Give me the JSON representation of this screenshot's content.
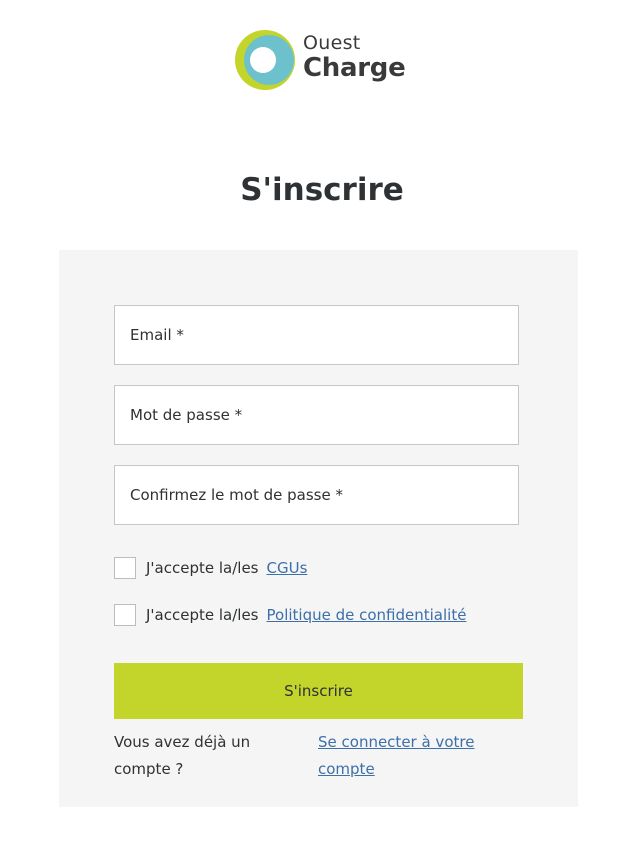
{
  "brand": {
    "line1": "Ouest",
    "line2": "Charge",
    "colors": {
      "lime": "#c3d42a",
      "teal": "#3aa0b1",
      "text": "#3a3a3a"
    }
  },
  "page": {
    "title": "S'inscrire"
  },
  "form": {
    "email_label": "Email *",
    "password_label": "Mot de passe *",
    "confirm_label": "Confirmez le mot de passe *",
    "terms": {
      "prefix": "J'accepte la/les",
      "link": "CGUs",
      "checked": false
    },
    "privacy": {
      "prefix": "J'accepte la/les",
      "link": "Politique de confidentialité",
      "checked": false
    },
    "submit_label": "S'inscrire",
    "already_text": "Vous avez déjà un compte ?",
    "login_link": "Se connecter à votre compte"
  },
  "colors": {
    "accent": "#c3d42a",
    "link": "#3d6fa8",
    "panel_bg": "#f5f5f5",
    "border": "#c6c6c6"
  }
}
